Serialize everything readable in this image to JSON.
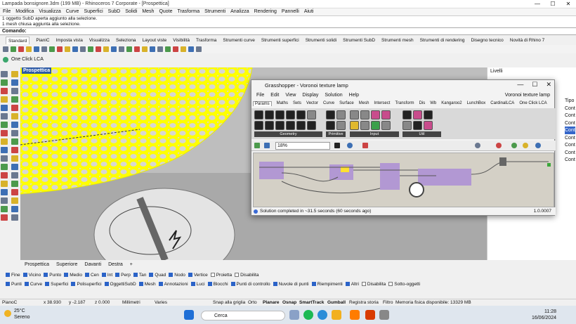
{
  "window": {
    "title": "Lampada bonsignore.3dm (199 MB) - Rhinoceros 7 Corporate - [Prospettica]",
    "controls": [
      "—",
      "☐",
      "✕"
    ]
  },
  "menu": [
    "File",
    "Modifica",
    "Visualizza",
    "Curve",
    "Superfici",
    "SubD",
    "Solidi",
    "Mesh",
    "Quote",
    "Trasforma",
    "Strumenti",
    "Analizza",
    "Rendering",
    "Pannelli",
    "Aiuti"
  ],
  "command_history": [
    "1 oggetto SubD aperta aggiunto alla selezione.",
    "1 mesh chiusa aggiunta alla selezione."
  ],
  "command_prompt": "Comando:",
  "toolbar_tabs": [
    "Standard",
    "PianiC",
    "Imposta vista",
    "Visualizza",
    "Seleziona",
    "Layout viste",
    "Visibilità",
    "Trasforma",
    "Strumenti curve",
    "Strumenti superfici",
    "Strumenti solidi",
    "Strumenti SubD",
    "Strumenti mesh",
    "Strumenti di rendering",
    "Disegno tecnico",
    "Novità di Rhino 7"
  ],
  "lca_label": "One Click LCA",
  "viewport": {
    "name": "Prospettica",
    "tabs": [
      "Prospettica",
      "Superiore",
      "Davanti",
      "Destra",
      "+"
    ]
  },
  "right_panel": {
    "title": "Livelli",
    "column": "Tipo",
    "rows": [
      "Cont",
      "Cont",
      "Cont",
      "Cont",
      "Cont",
      "Cont",
      "Cont",
      "Cont"
    ]
  },
  "grasshopper": {
    "title": "Grasshopper - Voronoi texture lamp",
    "menu": [
      "File",
      "Edit",
      "View",
      "Display",
      "Solution",
      "Help"
    ],
    "document": "Voronoi texture lamp",
    "tabs": [
      "Params",
      "Maths",
      "Sets",
      "Vector",
      "Curve",
      "Surface",
      "Mesh",
      "Intersect",
      "Transform",
      "Dis",
      "Wb",
      "Kangaroo2",
      "LunchBox",
      "CardinalLCA",
      "One Click LCA"
    ],
    "groups": [
      "Geometry",
      "Primitive",
      "Input",
      "Util"
    ],
    "zoom": "18%",
    "status": "Solution completed in ~31.5 seconds (60 seconds ago)",
    "version": "1.0.0007"
  },
  "osnap": [
    "Fine",
    "Vicino",
    "Punto",
    "Medio",
    "Cen",
    "Int",
    "Perp",
    "Tan",
    "Quad",
    "Nodo",
    "Vertice",
    "Proietta",
    "Disabilita"
  ],
  "osnap_off": [
    "Proietta",
    "Disabilita"
  ],
  "filters": [
    "Punti",
    "Curve",
    "Superfici",
    "Polisuperfici",
    "OggettiSubD",
    "Mesh",
    "Annotazioni",
    "Luci",
    "Blocchi",
    "Punti di controllo",
    "Nuvole di punti",
    "Riempimenti",
    "Altri",
    "Disabilita",
    "Sotto-oggetti"
  ],
  "filters_off": [
    "Disabilita",
    "Sotto-oggetti"
  ],
  "status": {
    "cplane": "PianoC",
    "x": "x 38.930",
    "y": "y -2.187",
    "z": "z 0.000",
    "units": "Millimetri",
    "layer": "Varies",
    "snap": "Snap alla griglia",
    "ortho": "Orto",
    "planar": "Planare",
    "osnap": "Osnap",
    "smarttrack": "SmartTrack",
    "gumball": "Gumball",
    "history": "Registra storia",
    "filter": "Filtro",
    "memory": "Memoria fisica disponibile: 13329 MB"
  },
  "taskbar": {
    "temp": "25°C",
    "weather": "Sereno",
    "search": "Cerca",
    "time": "11:28",
    "date": "16/06/2024"
  }
}
